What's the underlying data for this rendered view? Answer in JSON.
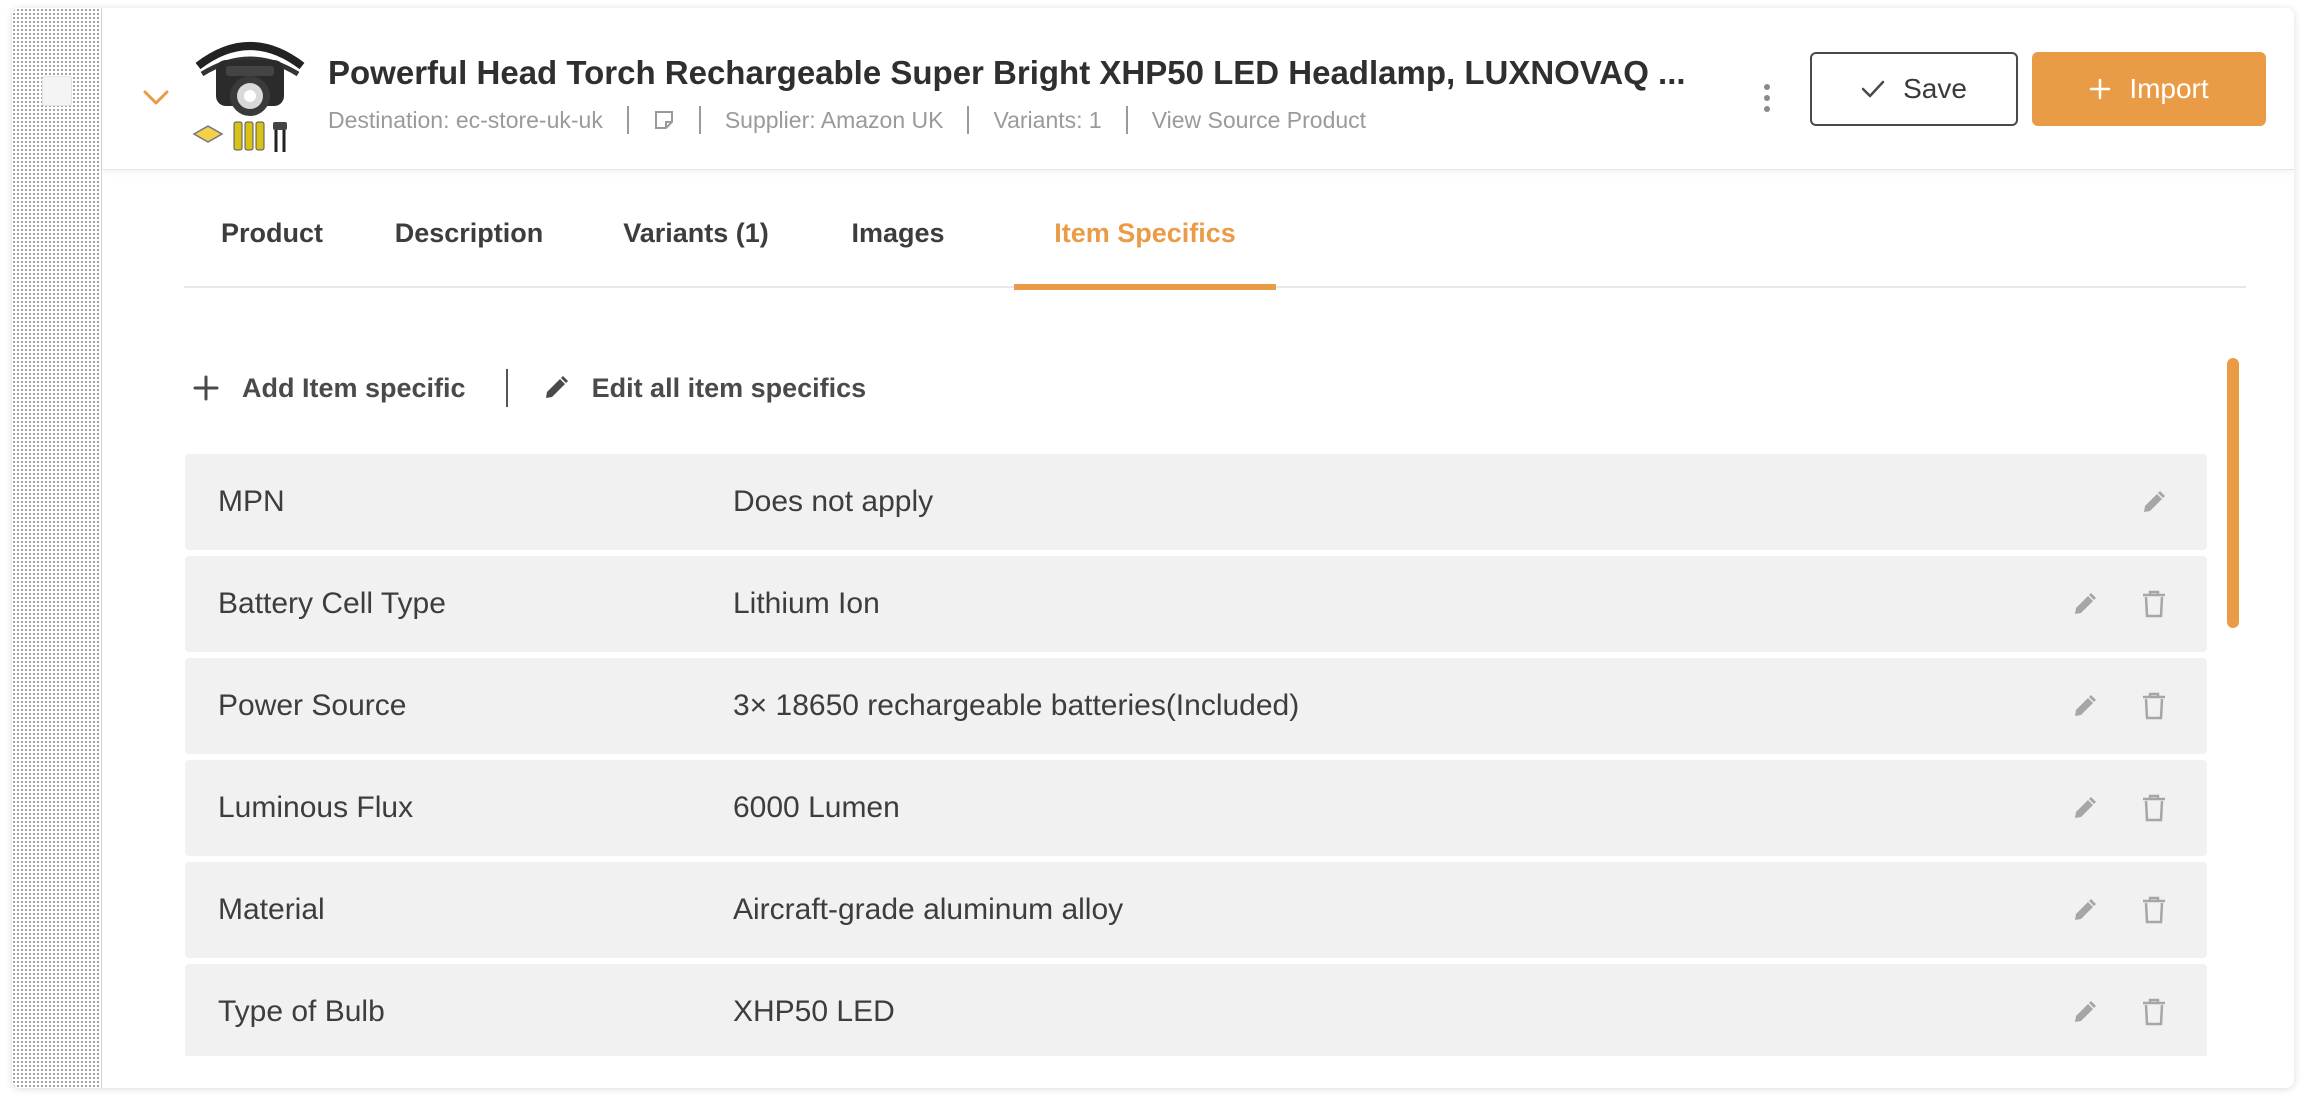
{
  "product": {
    "title": "Powerful Head Torch Rechargeable Super Bright XHP50 LED Headlamp, LUXNOVAQ ...",
    "destination": "Destination: ec-store-uk-uk",
    "supplier": "Supplier: Amazon UK",
    "variants": "Variants: 1",
    "view_source": "View Source Product"
  },
  "buttons": {
    "save": "Save",
    "import": "Import"
  },
  "tabs": [
    {
      "label": "Product"
    },
    {
      "label": "Description"
    },
    {
      "label": "Variants (1)"
    },
    {
      "label": "Images"
    },
    {
      "label": "Item Specifics",
      "active": true
    }
  ],
  "actions": {
    "add": "Add Item specific",
    "edit_all": "Edit all item specifics"
  },
  "item_specifics": [
    {
      "name": "MPN",
      "value": "Does not apply",
      "deletable": false
    },
    {
      "name": "Battery Cell Type",
      "value": "Lithium Ion",
      "deletable": true
    },
    {
      "name": "Power Source",
      "value": "3× 18650 rechargeable batteries(Included)",
      "deletable": true
    },
    {
      "name": "Luminous Flux",
      "value": "6000 Lumen",
      "deletable": true
    },
    {
      "name": "Material",
      "value": "Aircraft-grade aluminum alloy",
      "deletable": true
    },
    {
      "name": "Type of Bulb",
      "value": "XHP50 LED",
      "deletable": true
    }
  ],
  "icons": {
    "chevron": "chevron-down-icon",
    "note": "note-icon",
    "kebab": "more-vertical-icon",
    "check": "check-icon",
    "plus": "plus-icon",
    "pencil": "pencil-icon",
    "trash": "trash-icon"
  },
  "colors": {
    "accent": "#e99b46",
    "row_bg": "#f1f1f1",
    "muted_text": "#9a9a9a",
    "icon_gray": "#a6a6a6"
  }
}
